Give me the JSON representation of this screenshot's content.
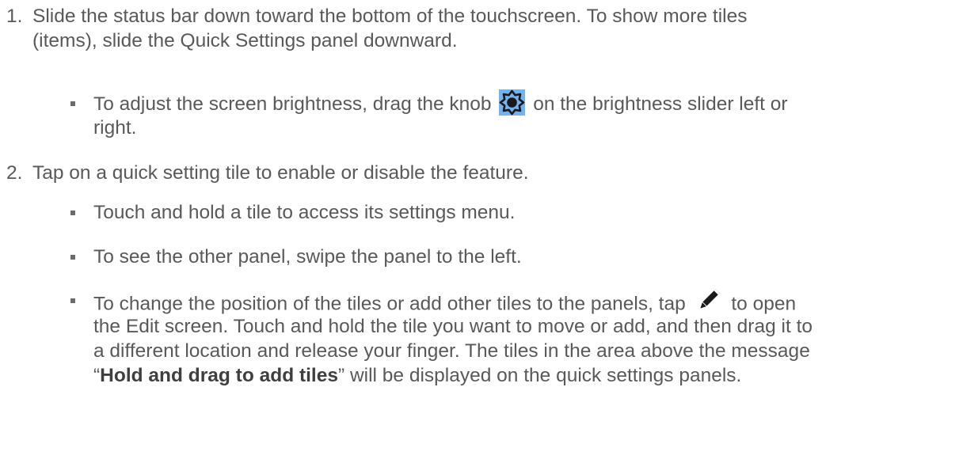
{
  "steps": [
    {
      "number": "1.",
      "lines": [
        "Slide the status bar down toward the bottom of the touchscreen. To show more tiles",
        "(items), slide the Quick Settings panel downward."
      ],
      "bullets": [
        {
          "before": "To adjust the screen brightness, drag the knob",
          "after": "on the brightness slider left or",
          "line2": "right.",
          "icon": "brightness-knob-icon"
        }
      ]
    },
    {
      "number": "2.",
      "lines": [
        "Tap on a quick setting tile to enable or disable the feature."
      ],
      "bullets": [
        {
          "text": "Touch and hold a tile to access its settings menu."
        },
        {
          "text": "To see the other panel, swipe the panel to the left."
        },
        {
          "before": "To change the position of the tiles or add other tiles to the panels, tap",
          "after": "to open",
          "icon": "pencil-edit-icon",
          "line2": "the Edit screen. Touch and hold the tile you want to move or add, and then drag it to",
          "line3": "a different location and release your finger. The tiles in the area above the message",
          "line4_open_quote": "“",
          "line4_bold": "Hold and drag to add tiles",
          "line4_rest": "” will be displayed on the quick settings panels."
        }
      ]
    }
  ],
  "colors": {
    "text": "#595959",
    "brightness_icon_bg": "#74b2f0",
    "icon": "#1a1a1a"
  }
}
